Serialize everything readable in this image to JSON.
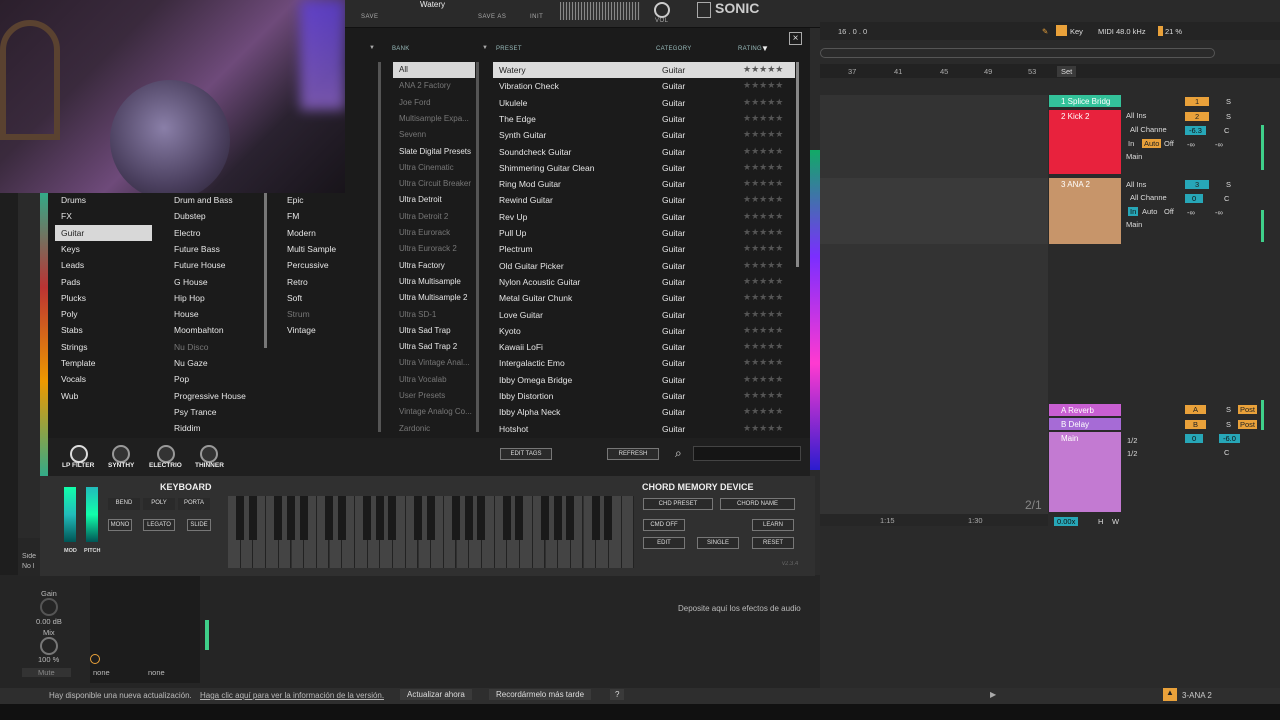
{
  "plugin": {
    "preset_name": "Watery",
    "top_labels": {
      "save": "SAVE",
      "save_as": "SAVE AS",
      "init": "INIT",
      "vol": "VOL"
    },
    "logo": "SONIC",
    "headers": {
      "bank": "BANK",
      "preset": "PRESET",
      "category": "CATEGORY",
      "rating": "RATING"
    },
    "close": "×"
  },
  "browser": {
    "category_col": [
      "Drums",
      "FX",
      "Guitar",
      "Keys",
      "Leads",
      "Pads",
      "Plucks",
      "Poly",
      "Stabs",
      "Strings",
      "Template",
      "Vocals",
      "Wub"
    ],
    "category_selected": 2,
    "genre_col": [
      {
        "t": "Drum and Bass",
        "d": false
      },
      {
        "t": "Dubstep",
        "d": false
      },
      {
        "t": "Electro",
        "d": false
      },
      {
        "t": "Future Bass",
        "d": false
      },
      {
        "t": "Future House",
        "d": false
      },
      {
        "t": "G House",
        "d": false
      },
      {
        "t": "Hip Hop",
        "d": false
      },
      {
        "t": "House",
        "d": false
      },
      {
        "t": "Moombahton",
        "d": false
      },
      {
        "t": "Nu Disco",
        "d": true
      },
      {
        "t": "Nu Gaze",
        "d": false
      },
      {
        "t": "Pop",
        "d": false
      },
      {
        "t": "Progressive House",
        "d": false
      },
      {
        "t": "Psy Trance",
        "d": false
      },
      {
        "t": "Riddim",
        "d": false
      }
    ],
    "style_col": [
      {
        "t": "Epic",
        "d": false
      },
      {
        "t": "FM",
        "d": false
      },
      {
        "t": "Modern",
        "d": false
      },
      {
        "t": "Multi Sample",
        "d": false
      },
      {
        "t": "Percussive",
        "d": false
      },
      {
        "t": "Retro",
        "d": false
      },
      {
        "t": "Soft",
        "d": false
      },
      {
        "t": "Strum",
        "d": true
      },
      {
        "t": "Vintage",
        "d": false
      }
    ],
    "bank_col": [
      {
        "t": "All",
        "d": false,
        "s": true
      },
      {
        "t": "ANA 2 Factory",
        "d": true
      },
      {
        "t": "Joe Ford",
        "d": true
      },
      {
        "t": "Multisample Expa...",
        "d": true
      },
      {
        "t": "Sevenn",
        "d": true
      },
      {
        "t": "Slate Digital Presets",
        "d": false
      },
      {
        "t": "Ultra Cinematic",
        "d": true
      },
      {
        "t": "Ultra Circuit Breaker",
        "d": true
      },
      {
        "t": "Ultra Detroit",
        "d": false
      },
      {
        "t": "Ultra Detroit 2",
        "d": true
      },
      {
        "t": "Ultra Eurorack",
        "d": true
      },
      {
        "t": "Ultra Eurorack 2",
        "d": true
      },
      {
        "t": "Ultra Factory",
        "d": false
      },
      {
        "t": "Ultra Multisample",
        "d": false
      },
      {
        "t": "Ultra Multisample 2",
        "d": false
      },
      {
        "t": "Ultra SD-1",
        "d": true
      },
      {
        "t": "Ultra Sad Trap",
        "d": false
      },
      {
        "t": "Ultra Sad Trap 2",
        "d": false
      },
      {
        "t": "Ultra Vintage Anal...",
        "d": true
      },
      {
        "t": "Ultra Vocalab",
        "d": true
      },
      {
        "t": "User Presets",
        "d": true
      },
      {
        "t": "Vintage Analog Co...",
        "d": true
      },
      {
        "t": "Zardonic",
        "d": true
      }
    ],
    "presets": [
      "Watery",
      "Vibration Check",
      "Ukulele",
      "The Edge",
      "Synth Guitar",
      "Soundcheck Guitar",
      "Shimmering Guitar Clean",
      "Ring Mod Guitar",
      "Rewind Guitar",
      "Rev Up",
      "Pull Up",
      "Plectrum",
      "Old Guitar Picker",
      "Nylon Acoustic Guitar",
      "Metal Guitar Chunk",
      "Love Guitar",
      "Kyoto",
      "Kawaii LoFi",
      "Intergalactic Emo",
      "Ibby Omega Bridge",
      "Ibby Distortion",
      "Ibby Alpha Neck",
      "Hotshot"
    ],
    "preset_category": "Guitar",
    "stars": "★★★★★"
  },
  "controls": {
    "knobs": [
      "LP FILTER",
      "SYNTHY",
      "ELECTRIO",
      "THINNER"
    ],
    "edit_tags": "EDIT TAGS",
    "refresh": "REFRESH",
    "keyboard": "KEYBOARD",
    "chord_memory": "CHORD MEMORY DEVICE",
    "bend": "BEND",
    "poly": "POLY",
    "porta": "PORTA",
    "mono": "MONO",
    "legato": "LEGATO",
    "slide": "SLIDE",
    "mod": "MOD",
    "pitch": "PITCH",
    "chd_preset": "CHD PRESET",
    "chord_name": "CHORD NAME",
    "cmd_off": "CMD OFF",
    "learn": "LEARN",
    "edit": "EDIT",
    "single": "SINGLE",
    "reset": "RESET",
    "version": "v2.3.4"
  },
  "daw": {
    "position": "16 .  0 .  0",
    "key": "Key",
    "midi": "MIDI",
    "sample_rate": "48.0 kHz",
    "cpu": "21 %",
    "ruler": [
      "37",
      "41",
      "45",
      "49",
      "53"
    ],
    "set": "Set",
    "tracks": [
      {
        "name": "1 Splice Bridg",
        "color": "#33c29a",
        "num": "1"
      },
      {
        "name": "2 Kick 2",
        "color": "#e8223d",
        "num": "2"
      },
      {
        "name": "3 ANA 2",
        "color": "#c7956a",
        "num": "3"
      }
    ],
    "returns": [
      {
        "name": "A Reverb",
        "color": "#c85fd2",
        "num": "A"
      },
      {
        "name": "B Delay",
        "color": "#a66bd6",
        "num": "B"
      },
      {
        "name": "Main",
        "color": "#c37ad2",
        "num": ""
      }
    ],
    "all_ins": "All Ins",
    "all_channels": "All Channe",
    "main": "Main",
    "in": "In",
    "auto": "Auto",
    "off": "Off",
    "post": "Post",
    "half": "1/2",
    "vol_val": "-6.3",
    "vol_val2": "0",
    "main_val": "-6.0",
    "s": "S",
    "c": "C",
    "inf": "-∞",
    "page": "2/1",
    "time1": "1:15",
    "time2": "1:30",
    "zoom": "0.00x",
    "h": "H",
    "w": "W",
    "drop_hint": "Deposite aquí los efectos de audio",
    "gain": "Gain",
    "gain_val": "0.00 dB",
    "mix": "Mix",
    "mix_val": "100 %",
    "mute": "Mute",
    "none1": "none",
    "none2": "none",
    "side": "Side",
    "nolo": "No l"
  },
  "status": {
    "msg": "Hay disponible una nueva actualización.",
    "link": "Haga clic aquí para ver la información de la versión.",
    "update": "Actualizar ahora",
    "later": "Recordármelo más tarde",
    "q": "?",
    "track_name": "3-ANA 2"
  }
}
